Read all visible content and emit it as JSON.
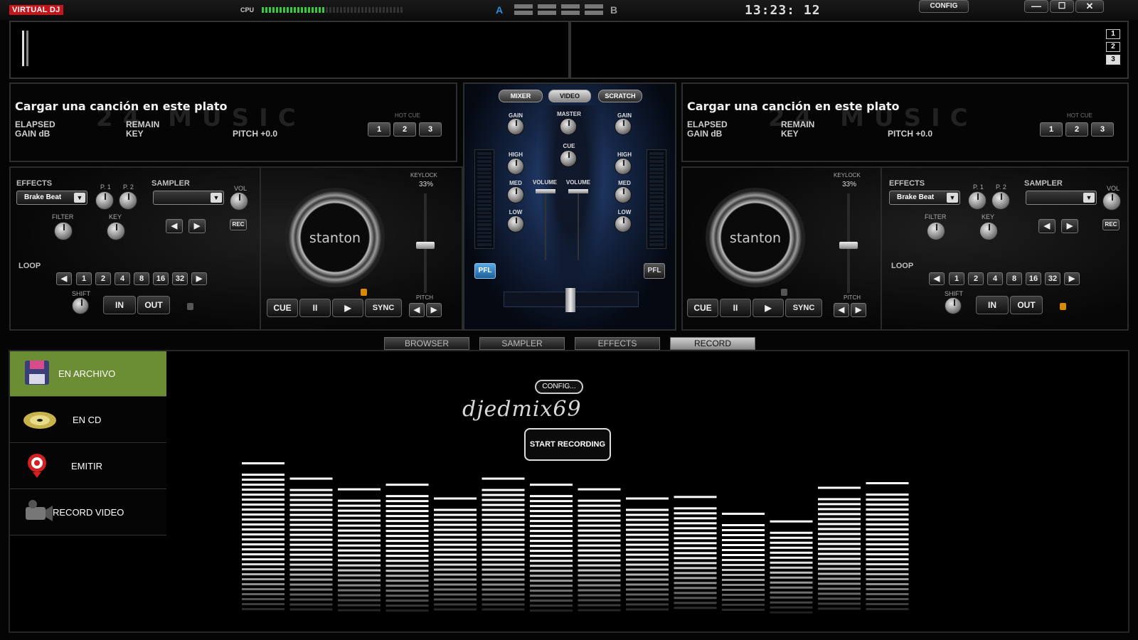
{
  "topbar": {
    "logo": "VIRTUAL DJ",
    "cpu_label": "CPU",
    "cpu_level": 0.45,
    "deck_a": "A",
    "deck_b": "B",
    "clock": "13:23: 12",
    "config": "CONFIG",
    "window_controls": [
      "minimize-icon",
      "maximize-icon",
      "close-icon"
    ],
    "layout_tabs": [
      "1",
      "2",
      "3"
    ]
  },
  "left_deck": {
    "title": "Cargar una canción en este plato",
    "elapsed": "ELAPSED",
    "remain": "REMAIN",
    "gain": "GAIN dB",
    "key": "KEY",
    "pitch": "PITCH +0.0",
    "hot_cue_label": "HOT CUE",
    "hot_cues": [
      "1",
      "2",
      "3"
    ],
    "effects_label": "EFFECTS",
    "effect": "Brake Beat",
    "p1": "P. 1",
    "p2": "P. 2",
    "sampler_label": "SAMPLER",
    "vol": "VOL",
    "filter": "FILTER",
    "key_knob": "KEY",
    "rec": "REC",
    "loop_label": "LOOP",
    "loops": [
      "1",
      "2",
      "4",
      "8",
      "16",
      "32"
    ],
    "shift": "SHIFT",
    "in": "IN",
    "out": "OUT",
    "keylock": "KEYLOCK",
    "keylock_pct": "33%",
    "platter_brand": "stanton",
    "cue": "CUE",
    "pause": "II",
    "sync": "SYNC",
    "pitch_label": "PITCH"
  },
  "right_deck": {
    "title": "Cargar una canción en este plato",
    "elapsed": "ELAPSED",
    "remain": "REMAIN",
    "gain": "GAIN dB",
    "key": "KEY",
    "pitch": "PITCH +0.0",
    "hot_cue_label": "HOT CUE",
    "hot_cues": [
      "1",
      "2",
      "3"
    ],
    "effects_label": "EFFECTS",
    "effect": "Brake Beat",
    "p1": "P. 1",
    "p2": "P. 2",
    "sampler_label": "SAMPLER",
    "vol": "VOL",
    "filter": "FILTER",
    "key_knob": "KEY",
    "rec": "REC",
    "loop_label": "LOOP",
    "loops": [
      "1",
      "2",
      "4",
      "8",
      "16",
      "32"
    ],
    "shift": "SHIFT",
    "in": "IN",
    "out": "OUT",
    "keylock": "KEYLOCK",
    "keylock_pct": "33%",
    "platter_brand": "stanton",
    "cue": "CUE",
    "pause": "II",
    "sync": "SYNC",
    "pitch_label": "PITCH"
  },
  "mixer": {
    "tabs": [
      "MIXER",
      "VIDEO",
      "SCRATCH"
    ],
    "gain": "GAIN",
    "master": "MASTER",
    "cue": "CUE",
    "high": "HIGH",
    "med": "MED",
    "low": "LOW",
    "volume": "VOLUME",
    "pfl": "PFL"
  },
  "bottom_tabs": [
    "BROWSER",
    "SAMPLER",
    "EFFECTS",
    "RECORD"
  ],
  "active_tab": "RECORD",
  "record": {
    "sources": [
      "EN ARCHIVO",
      "EN CD",
      "EMITIR",
      "RECORD VIDEO"
    ],
    "active_source": "EN ARCHIVO",
    "config_button": "CONFIG...",
    "signature": "djedmix69",
    "start_button": "START RECORDING",
    "eq_levels": [
      0.93,
      0.83,
      0.76,
      0.79,
      0.7,
      0.83,
      0.79,
      0.76,
      0.7,
      0.71,
      0.6,
      0.55,
      0.77,
      0.8
    ]
  },
  "colors": {
    "logo_red": "#c4161c",
    "active_source": "#6b8e34",
    "cpu_green": "#38c93e",
    "deck_a_blue": "#2b8fd6",
    "lock_orange": "#d98a00"
  }
}
